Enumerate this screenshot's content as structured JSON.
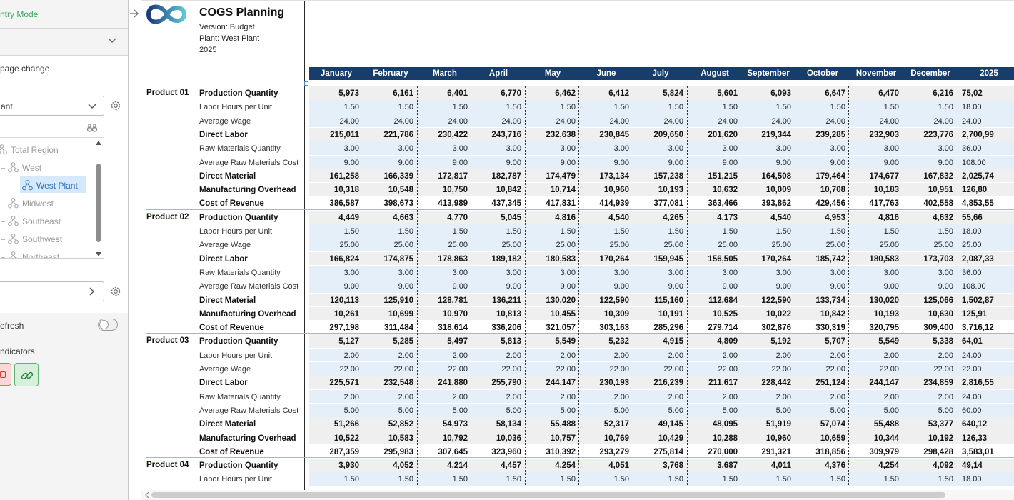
{
  "left_panel": {
    "entry_mode_label": "ntry Mode",
    "page_change_label": " page change",
    "plant_select_value": "ant",
    "tree_items": [
      {
        "label": "Total Region",
        "level": 0,
        "selected": false
      },
      {
        "label": "West",
        "level": 1,
        "selected": false
      },
      {
        "label": "West Plant",
        "level": 2,
        "selected": true
      },
      {
        "label": "Midwest",
        "level": 1,
        "selected": false
      },
      {
        "label": "Southeast",
        "level": 1,
        "selected": false
      },
      {
        "label": "Southwest",
        "level": 1,
        "selected": false
      },
      {
        "label": "Northeast",
        "level": 1,
        "selected": false
      }
    ],
    "refresh_label": "efresh",
    "indicators_label": "ndicators",
    "accent_green": "#3aa65a",
    "icons": {
      "collapse": "chevron-down-icon",
      "select": "chevron-down-icon",
      "settings": "gear-icon",
      "search": "binoculars-icon",
      "tree_node": "hierarchy-icon",
      "nav": "chevron-right-icon",
      "indicator_red": "square-icon",
      "indicator_green": "link-icon",
      "expand": "arrow-right-icon"
    }
  },
  "report": {
    "title": "COGS Planning",
    "version": "Version: Budget",
    "plant": "Plant: West Plant",
    "year": "2025",
    "header_color": "#173d6b",
    "months": [
      "January",
      "February",
      "March",
      "April",
      "May",
      "June",
      "July",
      "August",
      "September",
      "October",
      "November",
      "December"
    ],
    "total_header": "2025",
    "products": [
      {
        "name": "Product 01",
        "rows": [
          {
            "label": "Production Quantity",
            "bold": true,
            "values": [
              "5,973",
              "6,161",
              "6,401",
              "6,770",
              "6,462",
              "6,412",
              "5,824",
              "5,601",
              "6,093",
              "6,647",
              "6,470",
              "6,216"
            ],
            "total": "75,02"
          },
          {
            "label": "Labor Hours per Unit",
            "bold": false,
            "values": [
              "1.50",
              "1.50",
              "1.50",
              "1.50",
              "1.50",
              "1.50",
              "1.50",
              "1.50",
              "1.50",
              "1.50",
              "1.50",
              "1.50"
            ],
            "total": "18.00"
          },
          {
            "label": "Average Wage",
            "bold": false,
            "values": [
              "24.00",
              "24.00",
              "24.00",
              "24.00",
              "24.00",
              "24.00",
              "24.00",
              "24.00",
              "24.00",
              "24.00",
              "24.00",
              "24.00"
            ],
            "total": "24.00"
          },
          {
            "label": "Direct Labor",
            "bold": true,
            "values": [
              "215,011",
              "221,786",
              "230,422",
              "243,716",
              "232,638",
              "230,845",
              "209,650",
              "201,620",
              "219,344",
              "239,285",
              "232,903",
              "223,776"
            ],
            "total": "2,700,99"
          },
          {
            "label": "Raw Materials Quantity",
            "bold": false,
            "values": [
              "3.00",
              "3.00",
              "3.00",
              "3.00",
              "3.00",
              "3.00",
              "3.00",
              "3.00",
              "3.00",
              "3.00",
              "3.00",
              "3.00"
            ],
            "total": "36.00"
          },
          {
            "label": "Average Raw Materials Cost",
            "bold": false,
            "values": [
              "9.00",
              "9.00",
              "9.00",
              "9.00",
              "9.00",
              "9.00",
              "9.00",
              "9.00",
              "9.00",
              "9.00",
              "9.00",
              "9.00"
            ],
            "total": "108.00"
          },
          {
            "label": "Direct Material",
            "bold": true,
            "values": [
              "161,258",
              "166,339",
              "172,817",
              "182,787",
              "174,479",
              "173,134",
              "157,238",
              "151,215",
              "164,508",
              "179,464",
              "174,677",
              "167,832"
            ],
            "total": "2,025,74"
          },
          {
            "label": "Manufacturing Overhead",
            "bold": true,
            "values": [
              "10,318",
              "10,548",
              "10,750",
              "10,842",
              "10,714",
              "10,960",
              "10,193",
              "10,632",
              "10,009",
              "10,708",
              "10,183",
              "10,951"
            ],
            "total": "126,80"
          },
          {
            "label": "Cost of Revenue",
            "bold": true,
            "values": [
              "386,587",
              "398,673",
              "413,989",
              "437,345",
              "417,831",
              "414,939",
              "377,081",
              "363,466",
              "393,862",
              "429,456",
              "417,763",
              "402,558"
            ],
            "total": "4,853,55"
          }
        ]
      },
      {
        "name": "Product 02",
        "rows": [
          {
            "label": "Production Quantity",
            "bold": true,
            "values": [
              "4,449",
              "4,663",
              "4,770",
              "5,045",
              "4,816",
              "4,540",
              "4,265",
              "4,173",
              "4,540",
              "4,953",
              "4,816",
              "4,632"
            ],
            "total": "55,66"
          },
          {
            "label": "Labor Hours per Unit",
            "bold": false,
            "values": [
              "1.50",
              "1.50",
              "1.50",
              "1.50",
              "1.50",
              "1.50",
              "1.50",
              "1.50",
              "1.50",
              "1.50",
              "1.50",
              "1.50"
            ],
            "total": "18.00"
          },
          {
            "label": "Average Wage",
            "bold": false,
            "values": [
              "25.00",
              "25.00",
              "25.00",
              "25.00",
              "25.00",
              "25.00",
              "25.00",
              "25.00",
              "25.00",
              "25.00",
              "25.00",
              "25.00"
            ],
            "total": "25.00"
          },
          {
            "label": "Direct Labor",
            "bold": true,
            "values": [
              "166,824",
              "174,875",
              "178,863",
              "189,182",
              "180,583",
              "170,264",
              "159,945",
              "156,505",
              "170,264",
              "185,742",
              "180,583",
              "173,703"
            ],
            "total": "2,087,33"
          },
          {
            "label": "Raw Materials Quantity",
            "bold": false,
            "values": [
              "3.00",
              "3.00",
              "3.00",
              "3.00",
              "3.00",
              "3.00",
              "3.00",
              "3.00",
              "3.00",
              "3.00",
              "3.00",
              "3.00"
            ],
            "total": "36.00"
          },
          {
            "label": "Average Raw Materials Cost",
            "bold": false,
            "values": [
              "9.00",
              "9.00",
              "9.00",
              "9.00",
              "9.00",
              "9.00",
              "9.00",
              "9.00",
              "9.00",
              "9.00",
              "9.00",
              "9.00"
            ],
            "total": "108.00"
          },
          {
            "label": "Direct Material",
            "bold": true,
            "values": [
              "120,113",
              "125,910",
              "128,781",
              "136,211",
              "130,020",
              "122,590",
              "115,160",
              "112,684",
              "122,590",
              "133,734",
              "130,020",
              "125,066"
            ],
            "total": "1,502,87"
          },
          {
            "label": "Manufacturing Overhead",
            "bold": true,
            "values": [
              "10,261",
              "10,699",
              "10,970",
              "10,813",
              "10,455",
              "10,309",
              "10,191",
              "10,525",
              "10,022",
              "10,842",
              "10,193",
              "10,630"
            ],
            "total": "125,91"
          },
          {
            "label": "Cost of Revenue",
            "bold": true,
            "values": [
              "297,198",
              "311,484",
              "318,614",
              "336,206",
              "321,057",
              "303,163",
              "285,296",
              "279,714",
              "302,876",
              "330,319",
              "320,795",
              "309,400"
            ],
            "total": "3,716,12"
          }
        ]
      },
      {
        "name": "Product 03",
        "rows": [
          {
            "label": "Production Quantity",
            "bold": true,
            "values": [
              "5,127",
              "5,285",
              "5,497",
              "5,813",
              "5,549",
              "5,232",
              "4,915",
              "4,809",
              "5,192",
              "5,707",
              "5,549",
              "5,338"
            ],
            "total": "64,01"
          },
          {
            "label": "Labor Hours per Unit",
            "bold": false,
            "values": [
              "2.00",
              "2.00",
              "2.00",
              "2.00",
              "2.00",
              "2.00",
              "2.00",
              "2.00",
              "2.00",
              "2.00",
              "2.00",
              "2.00"
            ],
            "total": "24.00"
          },
          {
            "label": "Average Wage",
            "bold": false,
            "values": [
              "22.00",
              "22.00",
              "22.00",
              "22.00",
              "22.00",
              "22.00",
              "22.00",
              "22.00",
              "22.00",
              "22.00",
              "22.00",
              "22.00"
            ],
            "total": "22.00"
          },
          {
            "label": "Direct Labor",
            "bold": true,
            "values": [
              "225,571",
              "232,548",
              "241,880",
              "255,790",
              "244,147",
              "230,193",
              "216,239",
              "211,617",
              "228,442",
              "251,124",
              "244,147",
              "234,859"
            ],
            "total": "2,816,55"
          },
          {
            "label": "Raw Materials Quantity",
            "bold": false,
            "values": [
              "2.00",
              "2.00",
              "2.00",
              "2.00",
              "2.00",
              "2.00",
              "2.00",
              "2.00",
              "2.00",
              "2.00",
              "2.00",
              "2.00"
            ],
            "total": "24.00"
          },
          {
            "label": "Average Raw Materials Cost",
            "bold": false,
            "values": [
              "5.00",
              "5.00",
              "5.00",
              "5.00",
              "5.00",
              "5.00",
              "5.00",
              "5.00",
              "5.00",
              "5.00",
              "5.00",
              "5.00"
            ],
            "total": "60.00"
          },
          {
            "label": "Direct Material",
            "bold": true,
            "values": [
              "51,266",
              "52,852",
              "54,973",
              "58,134",
              "55,488",
              "52,317",
              "49,145",
              "48,095",
              "51,919",
              "57,074",
              "55,488",
              "53,377"
            ],
            "total": "640,12"
          },
          {
            "label": "Manufacturing Overhead",
            "bold": true,
            "values": [
              "10,522",
              "10,583",
              "10,792",
              "10,036",
              "10,757",
              "10,769",
              "10,429",
              "10,288",
              "10,960",
              "10,659",
              "10,344",
              "10,192"
            ],
            "total": "126,33"
          },
          {
            "label": "Cost of Revenue",
            "bold": true,
            "values": [
              "287,359",
              "295,983",
              "307,645",
              "323,960",
              "310,392",
              "293,279",
              "275,814",
              "270,000",
              "291,321",
              "318,856",
              "309,979",
              "298,428"
            ],
            "total": "3,583,01"
          }
        ]
      },
      {
        "name": "Product 04",
        "rows": [
          {
            "label": "Production Quantity",
            "bold": true,
            "values": [
              "3,930",
              "4,052",
              "4,214",
              "4,457",
              "4,254",
              "4,051",
              "3,768",
              "3,687",
              "4,011",
              "4,376",
              "4,254",
              "4,092"
            ],
            "total": "49,14"
          },
          {
            "label": "Labor Hours per Unit",
            "bold": false,
            "values": [
              "1.50",
              "1.50",
              "1.50",
              "1.50",
              "1.50",
              "1.50",
              "1.50",
              "1.50",
              "1.50",
              "1.50",
              "1.50",
              "1.50"
            ],
            "total": "18.00"
          }
        ]
      }
    ]
  }
}
